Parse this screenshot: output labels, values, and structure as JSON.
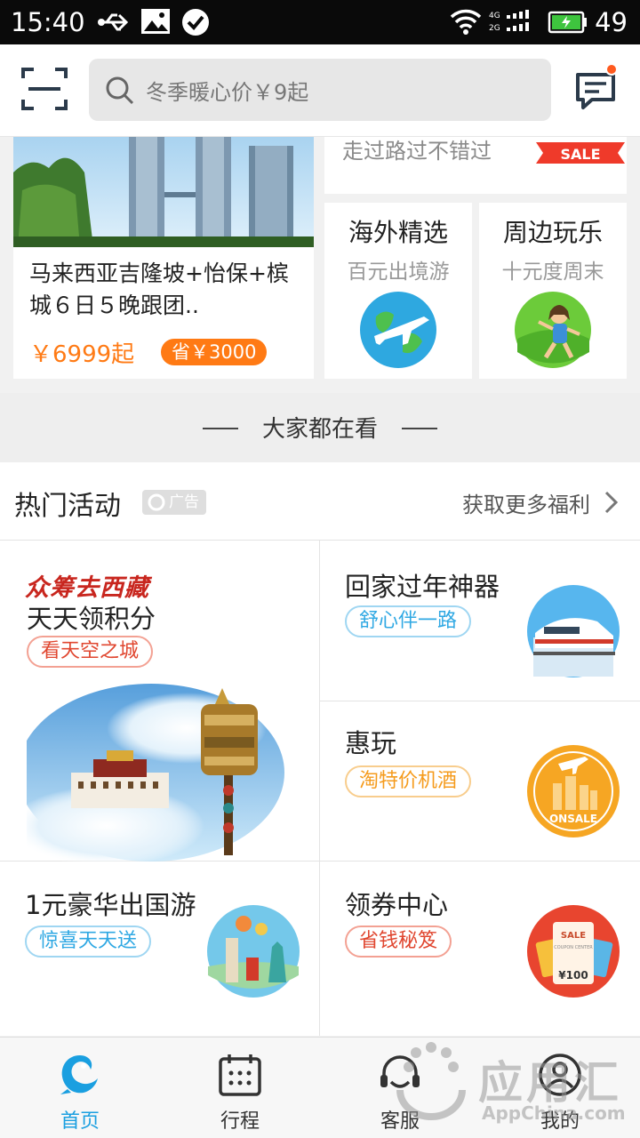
{
  "status_bar": {
    "time": "15:40",
    "battery_level": "49",
    "icons": [
      "usb-icon",
      "image-icon",
      "check-circle-icon",
      "wifi-icon",
      "signal-icon",
      "battery-icon"
    ]
  },
  "header": {
    "search_placeholder": "冬季暖心价￥9起",
    "icons": [
      "scan-icon",
      "search-icon",
      "message-icon"
    ]
  },
  "top_cards": {
    "main": {
      "title": "马来西亚吉隆坡+怡保+槟城６日５晚跟团..",
      "price": "￥6999起",
      "save_badge": "省￥3000"
    },
    "sale": {
      "subtitle": "走过路过不错过",
      "tag": "SALE"
    },
    "overseas": {
      "title": "海外精选",
      "subtitle": "百元出境游"
    },
    "nearby": {
      "title": "周边玩乐",
      "subtitle": "十元度周末"
    }
  },
  "divider": {
    "text": "大家都在看"
  },
  "hot_activities": {
    "title": "热门活动",
    "ad_label": "广告",
    "more_link": "获取更多福利",
    "tiles": {
      "tibet": {
        "brand": "众筹去西藏",
        "title": "天天领积分",
        "pill": "看天空之城"
      },
      "new_year": {
        "title": "回家过年神器",
        "pill": "舒心伴一路"
      },
      "huiwan": {
        "title": "惠玩",
        "pill": "淘特价机酒",
        "badge": "ONSALE"
      },
      "abroad": {
        "title": "1元豪华出国游",
        "pill": "惊喜天天送"
      },
      "coupon": {
        "title": "领券中心",
        "pill": "省钱秘笈",
        "coupon_top": "SALE",
        "coupon_sub": "COUPON CENTER",
        "coupon_price": "¥100"
      }
    }
  },
  "tabbar": {
    "tabs": [
      {
        "label": "首页",
        "icon": "dolphin-home-icon",
        "active": true
      },
      {
        "label": "行程",
        "icon": "calendar-icon",
        "active": false
      },
      {
        "label": "客服",
        "icon": "headset-icon",
        "active": false
      },
      {
        "label": "我的",
        "icon": "profile-icon",
        "active": false
      }
    ]
  },
  "watermark": {
    "big": "应用汇",
    "small": "AppChina.com"
  },
  "colors": {
    "accent_blue": "#1a9fe0",
    "price_orange": "#ff7a14",
    "brand_red": "#c8261e"
  }
}
